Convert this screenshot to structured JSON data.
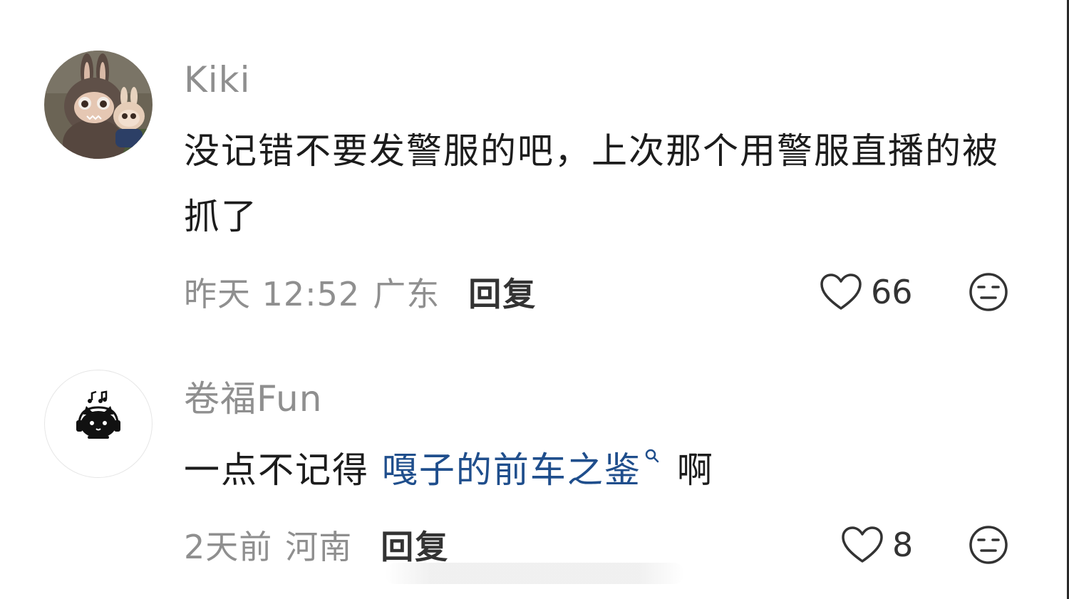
{
  "comments": [
    {
      "username": "Kiki",
      "text": "没记错不要发警服的吧，上次那个用警服直播的被抓了",
      "time": "昨天 12:52",
      "location": "广东",
      "reply_label": "回复",
      "likes": "66",
      "avatar_icon": "plush-toy-photo-avatar",
      "like_icon": "heart-outline-icon",
      "emoji_icon": "neutral-face-icon"
    },
    {
      "username": "卷福Fun",
      "text_before": "一点不记得",
      "link_text": "嘎子的前车之鉴",
      "text_after": "啊",
      "time": "2天前",
      "location": "河南",
      "reply_label": "回复",
      "likes": "8",
      "avatar_icon": "cartoon-cat-headphones-avatar",
      "like_icon": "heart-outline-icon",
      "emoji_icon": "neutral-face-icon"
    }
  ],
  "colors": {
    "username": "#8f8f8f",
    "body": "#1c1c1c",
    "link": "#1f4e8c",
    "meta": "#8f8f8f",
    "reply": "#333333"
  }
}
